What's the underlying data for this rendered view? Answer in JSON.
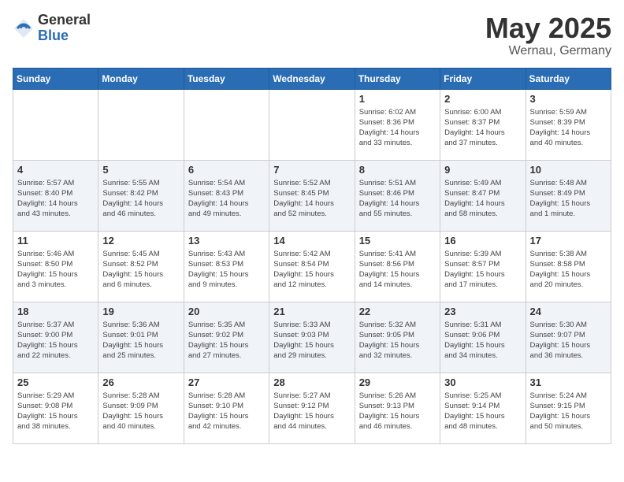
{
  "header": {
    "logo_general": "General",
    "logo_blue": "Blue",
    "title": "May 2025",
    "location": "Wernau, Germany"
  },
  "days_of_week": [
    "Sunday",
    "Monday",
    "Tuesday",
    "Wednesday",
    "Thursday",
    "Friday",
    "Saturday"
  ],
  "weeks": [
    [
      {
        "day": "",
        "info": ""
      },
      {
        "day": "",
        "info": ""
      },
      {
        "day": "",
        "info": ""
      },
      {
        "day": "",
        "info": ""
      },
      {
        "day": "1",
        "info": "Sunrise: 6:02 AM\nSunset: 8:36 PM\nDaylight: 14 hours\nand 33 minutes."
      },
      {
        "day": "2",
        "info": "Sunrise: 6:00 AM\nSunset: 8:37 PM\nDaylight: 14 hours\nand 37 minutes."
      },
      {
        "day": "3",
        "info": "Sunrise: 5:59 AM\nSunset: 8:39 PM\nDaylight: 14 hours\nand 40 minutes."
      }
    ],
    [
      {
        "day": "4",
        "info": "Sunrise: 5:57 AM\nSunset: 8:40 PM\nDaylight: 14 hours\nand 43 minutes."
      },
      {
        "day": "5",
        "info": "Sunrise: 5:55 AM\nSunset: 8:42 PM\nDaylight: 14 hours\nand 46 minutes."
      },
      {
        "day": "6",
        "info": "Sunrise: 5:54 AM\nSunset: 8:43 PM\nDaylight: 14 hours\nand 49 minutes."
      },
      {
        "day": "7",
        "info": "Sunrise: 5:52 AM\nSunset: 8:45 PM\nDaylight: 14 hours\nand 52 minutes."
      },
      {
        "day": "8",
        "info": "Sunrise: 5:51 AM\nSunset: 8:46 PM\nDaylight: 14 hours\nand 55 minutes."
      },
      {
        "day": "9",
        "info": "Sunrise: 5:49 AM\nSunset: 8:47 PM\nDaylight: 14 hours\nand 58 minutes."
      },
      {
        "day": "10",
        "info": "Sunrise: 5:48 AM\nSunset: 8:49 PM\nDaylight: 15 hours\nand 1 minute."
      }
    ],
    [
      {
        "day": "11",
        "info": "Sunrise: 5:46 AM\nSunset: 8:50 PM\nDaylight: 15 hours\nand 3 minutes."
      },
      {
        "day": "12",
        "info": "Sunrise: 5:45 AM\nSunset: 8:52 PM\nDaylight: 15 hours\nand 6 minutes."
      },
      {
        "day": "13",
        "info": "Sunrise: 5:43 AM\nSunset: 8:53 PM\nDaylight: 15 hours\nand 9 minutes."
      },
      {
        "day": "14",
        "info": "Sunrise: 5:42 AM\nSunset: 8:54 PM\nDaylight: 15 hours\nand 12 minutes."
      },
      {
        "day": "15",
        "info": "Sunrise: 5:41 AM\nSunset: 8:56 PM\nDaylight: 15 hours\nand 14 minutes."
      },
      {
        "day": "16",
        "info": "Sunrise: 5:39 AM\nSunset: 8:57 PM\nDaylight: 15 hours\nand 17 minutes."
      },
      {
        "day": "17",
        "info": "Sunrise: 5:38 AM\nSunset: 8:58 PM\nDaylight: 15 hours\nand 20 minutes."
      }
    ],
    [
      {
        "day": "18",
        "info": "Sunrise: 5:37 AM\nSunset: 9:00 PM\nDaylight: 15 hours\nand 22 minutes."
      },
      {
        "day": "19",
        "info": "Sunrise: 5:36 AM\nSunset: 9:01 PM\nDaylight: 15 hours\nand 25 minutes."
      },
      {
        "day": "20",
        "info": "Sunrise: 5:35 AM\nSunset: 9:02 PM\nDaylight: 15 hours\nand 27 minutes."
      },
      {
        "day": "21",
        "info": "Sunrise: 5:33 AM\nSunset: 9:03 PM\nDaylight: 15 hours\nand 29 minutes."
      },
      {
        "day": "22",
        "info": "Sunrise: 5:32 AM\nSunset: 9:05 PM\nDaylight: 15 hours\nand 32 minutes."
      },
      {
        "day": "23",
        "info": "Sunrise: 5:31 AM\nSunset: 9:06 PM\nDaylight: 15 hours\nand 34 minutes."
      },
      {
        "day": "24",
        "info": "Sunrise: 5:30 AM\nSunset: 9:07 PM\nDaylight: 15 hours\nand 36 minutes."
      }
    ],
    [
      {
        "day": "25",
        "info": "Sunrise: 5:29 AM\nSunset: 9:08 PM\nDaylight: 15 hours\nand 38 minutes."
      },
      {
        "day": "26",
        "info": "Sunrise: 5:28 AM\nSunset: 9:09 PM\nDaylight: 15 hours\nand 40 minutes."
      },
      {
        "day": "27",
        "info": "Sunrise: 5:28 AM\nSunset: 9:10 PM\nDaylight: 15 hours\nand 42 minutes."
      },
      {
        "day": "28",
        "info": "Sunrise: 5:27 AM\nSunset: 9:12 PM\nDaylight: 15 hours\nand 44 minutes."
      },
      {
        "day": "29",
        "info": "Sunrise: 5:26 AM\nSunset: 9:13 PM\nDaylight: 15 hours\nand 46 minutes."
      },
      {
        "day": "30",
        "info": "Sunrise: 5:25 AM\nSunset: 9:14 PM\nDaylight: 15 hours\nand 48 minutes."
      },
      {
        "day": "31",
        "info": "Sunrise: 5:24 AM\nSunset: 9:15 PM\nDaylight: 15 hours\nand 50 minutes."
      }
    ]
  ]
}
